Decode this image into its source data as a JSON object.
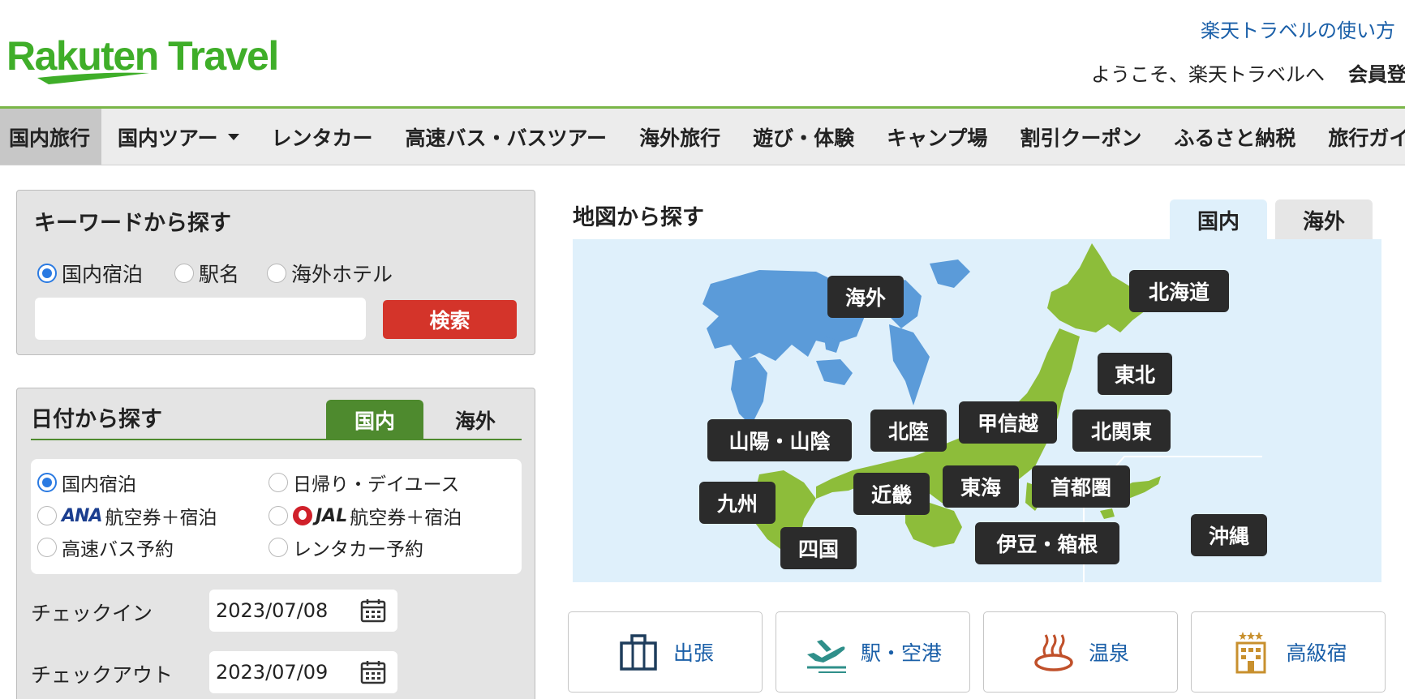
{
  "header": {
    "logo_text": "Rakuten Travel",
    "help_link": "楽天トラベルの使い方",
    "welcome": "ようこそ、楽天トラベルへ",
    "register": "会員登録"
  },
  "nav": {
    "items": [
      {
        "label": "国内旅行"
      },
      {
        "label": "国内ツアー"
      },
      {
        "label": "レンタカー"
      },
      {
        "label": "高速バス・バスツアー"
      },
      {
        "label": "海外旅行"
      },
      {
        "label": "遊び・体験"
      },
      {
        "label": "キャンプ場"
      },
      {
        "label": "割引クーポン"
      },
      {
        "label": "ふるさと納税"
      },
      {
        "label": "旅行ガイド"
      }
    ]
  },
  "keyword": {
    "title": "キーワードから探す",
    "options": [
      {
        "label": "国内宿泊",
        "selected": true
      },
      {
        "label": "駅名",
        "selected": false
      },
      {
        "label": "海外ホテル",
        "selected": false
      }
    ],
    "input_value": "",
    "search_label": "検索"
  },
  "date_search": {
    "title": "日付から探す",
    "tab_domestic": "国内",
    "tab_overseas": "海外",
    "options": {
      "domestic_stay": "国内宿泊",
      "day_use": "日帰り・デイユース",
      "ana_logo": "ANA",
      "ana_label": "航空券＋宿泊",
      "jal_logo": "JAL",
      "jal_label": "航空券＋宿泊",
      "bus": "高速バス予約",
      "rental": "レンタカー予約"
    },
    "checkin_label": "チェックイン",
    "checkin_value": "2023/07/08",
    "checkout_label": "チェックアウト",
    "checkout_value": "2023/07/09"
  },
  "map": {
    "title": "地図から探す",
    "tab_domestic": "国内",
    "tab_overseas": "海外",
    "regions": {
      "overseas": "海外",
      "hokkaido": "北海道",
      "tohoku": "東北",
      "kitakanto": "北関東",
      "koshinetsu": "甲信越",
      "hokuriku": "北陸",
      "sanyo": "山陽・山陰",
      "kyushu": "九州",
      "kinki": "近畿",
      "tokai": "東海",
      "shutoken": "首都圏",
      "shikoku": "四国",
      "izu": "伊豆・箱根",
      "okinawa": "沖縄"
    },
    "colors": {
      "land": "#8dbd3a",
      "world": "#5b9bd9",
      "sea": "#dff0fb"
    }
  },
  "categories": [
    {
      "label": "出張",
      "icon": "briefcase-icon"
    },
    {
      "label": "駅・空港",
      "icon": "airplane-icon"
    },
    {
      "label": "温泉",
      "icon": "hot-spring-icon"
    },
    {
      "label": "高級宿",
      "icon": "luxury-hotel-icon"
    }
  ],
  "colors": {
    "brand_green": "#3fae29",
    "accent_red": "#d4342a",
    "tab_green": "#4e8a2e",
    "link_blue": "#1a5fa8"
  }
}
